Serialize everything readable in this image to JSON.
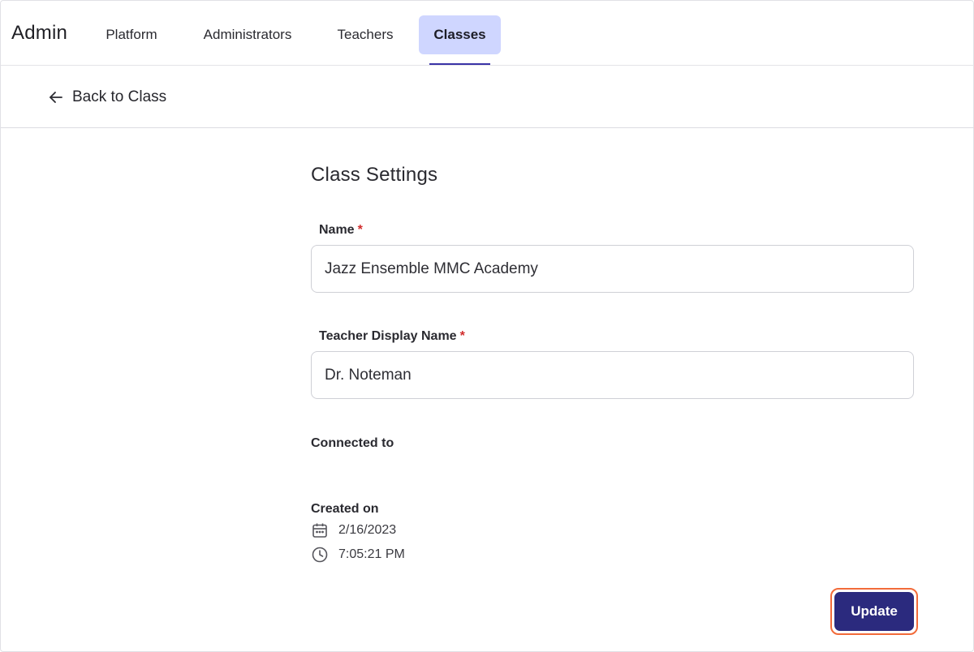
{
  "header": {
    "brand": "Admin",
    "tabs": [
      {
        "label": "Platform"
      },
      {
        "label": "Administrators"
      },
      {
        "label": "Teachers"
      },
      {
        "label": "Classes",
        "active": true
      }
    ]
  },
  "subnav": {
    "back_label": "Back to Class",
    "back_icon": "arrow-left-icon"
  },
  "form": {
    "title": "Class Settings",
    "name_label": "Name",
    "name_required_mark": "*",
    "name_value": "Jazz Ensemble MMC Academy",
    "teacher_label": "Teacher Display Name",
    "teacher_required_mark": "*",
    "teacher_value": "Dr. Noteman",
    "connected_label": "Connected to",
    "created_label": "Created on",
    "created_date": "2/16/2023",
    "created_time": "7:05:21 PM",
    "update_label": "Update"
  },
  "colors": {
    "active_tab_bg": "#cfd6ff",
    "tab_underline": "#3a33a6",
    "primary_button": "#2b2a7e",
    "focus_ring": "#f26b3a",
    "required": "#d12c2c"
  }
}
